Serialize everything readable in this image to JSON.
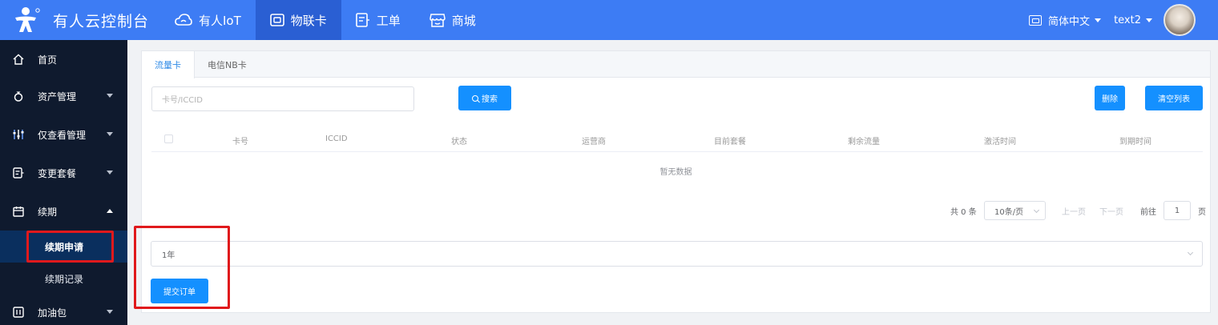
{
  "header": {
    "brand": "有人云控制台",
    "nav": [
      {
        "label": "有人IoT",
        "icon": "cloud-icon"
      },
      {
        "label": "物联卡",
        "icon": "sim-card-icon",
        "active": true
      },
      {
        "label": "工单",
        "icon": "work-order-icon"
      },
      {
        "label": "商城",
        "icon": "shop-icon"
      }
    ],
    "language": "简体中文",
    "username": "text2"
  },
  "sidebar": {
    "items": [
      {
        "label": "首页",
        "icon": "home-icon"
      },
      {
        "label": "资产管理",
        "icon": "asset-icon"
      },
      {
        "label": "仅查看管理",
        "icon": "sliders-icon"
      },
      {
        "label": "变更套餐",
        "icon": "plan-icon"
      },
      {
        "label": "续期",
        "icon": "calendar-icon",
        "expanded": true
      },
      {
        "label": "加油包",
        "icon": "package-icon"
      }
    ],
    "sub_items": [
      {
        "label": "续期申请",
        "active": true
      },
      {
        "label": "续期记录"
      }
    ]
  },
  "tabs": [
    {
      "label": "流量卡",
      "active": true
    },
    {
      "label": "电信NB卡"
    }
  ],
  "search": {
    "placeholder": "卡号/ICCID",
    "button": "搜索"
  },
  "actions": {
    "delete": "删除",
    "clear": "清空列表"
  },
  "table": {
    "columns": [
      "卡号",
      "ICCID",
      "状态",
      "运营商",
      "目前套餐",
      "剩余流量",
      "激活时间",
      "到期时间"
    ],
    "empty_text": "暂无数据"
  },
  "pagination": {
    "total": "共 0 条",
    "page_size": "10条/页",
    "prev": "上一页",
    "next": "下一页",
    "goto": "前往",
    "page": "1",
    "unit": "页"
  },
  "form": {
    "period": "1年",
    "submit": "提交订单"
  },
  "colors": {
    "topbar": "#3d7cf4",
    "sidebar": "#0f1a2e",
    "primary": "#1490ff",
    "highlight": "#e0191c"
  }
}
